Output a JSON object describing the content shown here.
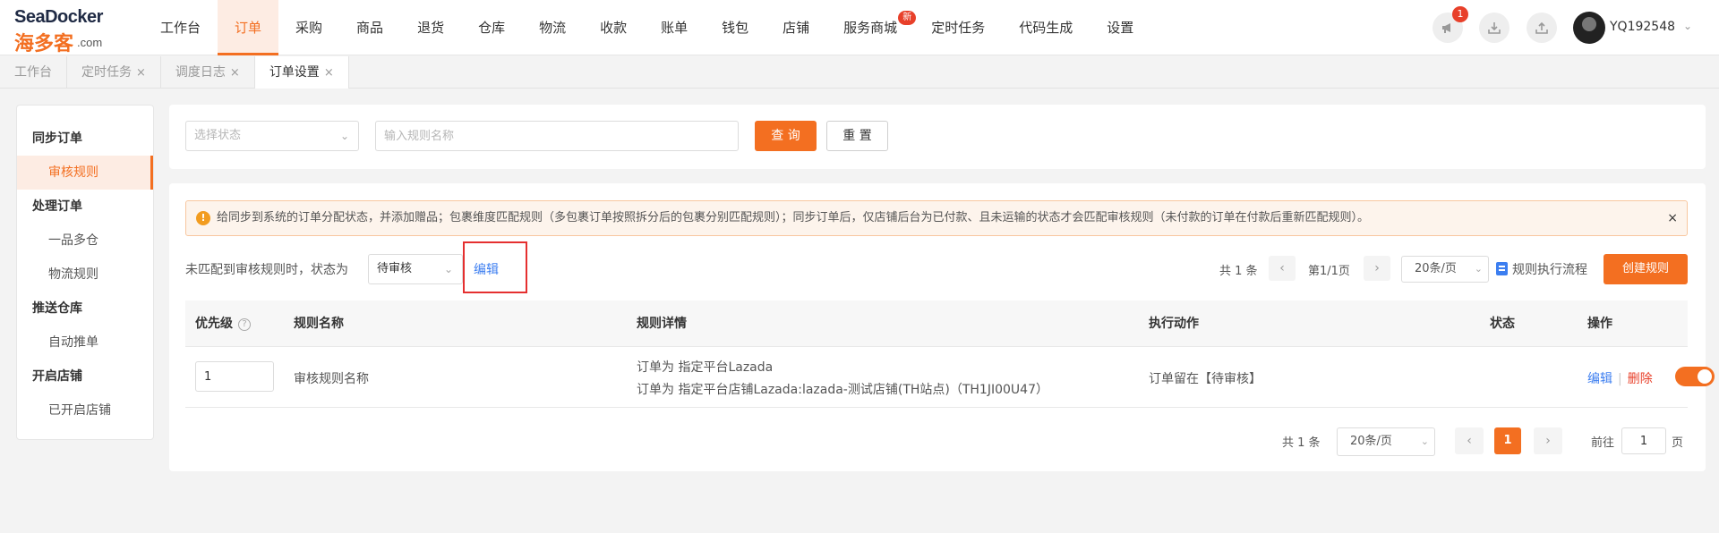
{
  "app": {
    "logo_text": "SeaDocker",
    "logo_cn": "海多客",
    "logo_domain": ".com",
    "brand_color": "#f36f21",
    "link_color": "#3c7ef0",
    "danger_color": "#e8402a"
  },
  "nav": {
    "items": [
      {
        "label": "工作台"
      },
      {
        "label": "订单",
        "active": true
      },
      {
        "label": "采购"
      },
      {
        "label": "商品"
      },
      {
        "label": "退货"
      },
      {
        "label": "仓库"
      },
      {
        "label": "物流"
      },
      {
        "label": "收款"
      },
      {
        "label": "账单"
      },
      {
        "label": "钱包"
      },
      {
        "label": "店铺"
      },
      {
        "label": "服务商城",
        "badge": "新"
      },
      {
        "label": "定时任务"
      },
      {
        "label": "代码生成"
      },
      {
        "label": "设置"
      }
    ]
  },
  "header": {
    "notification_icon": "megaphone-icon",
    "notification_count": "1",
    "download_icon": "download-icon",
    "upload_icon": "upload-icon",
    "username": "YQ192548",
    "user_caret": "⌄"
  },
  "tabs": {
    "items": [
      {
        "label": "工作台",
        "closable": false
      },
      {
        "label": "定时任务",
        "closable": true
      },
      {
        "label": "调度日志",
        "closable": true
      },
      {
        "label": "订单设置",
        "closable": true,
        "active": true
      }
    ],
    "close_glyph": "×"
  },
  "sidebar": {
    "groups": [
      {
        "label": "同步订单",
        "items": [
          {
            "label": "审核规则",
            "active": true
          }
        ]
      },
      {
        "label": "处理订单",
        "items": [
          {
            "label": "一品多仓"
          },
          {
            "label": "物流规则"
          }
        ]
      },
      {
        "label": "推送仓库",
        "items": [
          {
            "label": "自动推单"
          }
        ]
      },
      {
        "label": "开启店铺",
        "items": [
          {
            "label": "已开启店铺"
          }
        ]
      }
    ]
  },
  "filters": {
    "status_placeholder": "选择状态",
    "rule_name_placeholder": "输入规则名称",
    "query_label": "查 询",
    "reset_label": "重 置"
  },
  "alert": {
    "text": "给同步到系统的订单分配状态，并添加赠品；包裹维度匹配规则（多包裹订单按照拆分后的包裹分别匹配规则）；同步订单后，仅店铺后台为已付款、且未运输的状态才会匹配审核规则（未付款的订单在付款后重新匹配规则）。",
    "icon": "info-icon",
    "close": "×"
  },
  "toolbar": {
    "unmatched_label": "未匹配到审核规则时，状态为",
    "unmatched_value": "待审核",
    "edit_label": "编辑",
    "total": "共 1 条",
    "page_info": "第1/1页",
    "page_size": "20条/页",
    "flow_label": "规则执行流程",
    "create_label": "创建规则"
  },
  "table": {
    "headers": {
      "priority": "优先级",
      "name": "规则名称",
      "detail": "规则详情",
      "action": "执行动作",
      "status": "状态",
      "ops": "操作"
    },
    "rows": [
      {
        "priority": "1",
        "name": "审核规则名称",
        "detail_line1": "订单为 指定平台Lazada",
        "detail_line2": "订单为 指定平台店铺Lazada:lazada-测试店铺(TH站点)（TH1JI00U47）",
        "action": "订单留在【待审核】",
        "status_on": true,
        "edit": "编辑",
        "delete": "删除"
      }
    ]
  },
  "pagination": {
    "total": "共 1 条",
    "page_size": "20条/页",
    "prev": "‹",
    "next": "›",
    "current": "1",
    "goto_label": "前往",
    "goto_value": "1",
    "page_suffix": "页"
  }
}
